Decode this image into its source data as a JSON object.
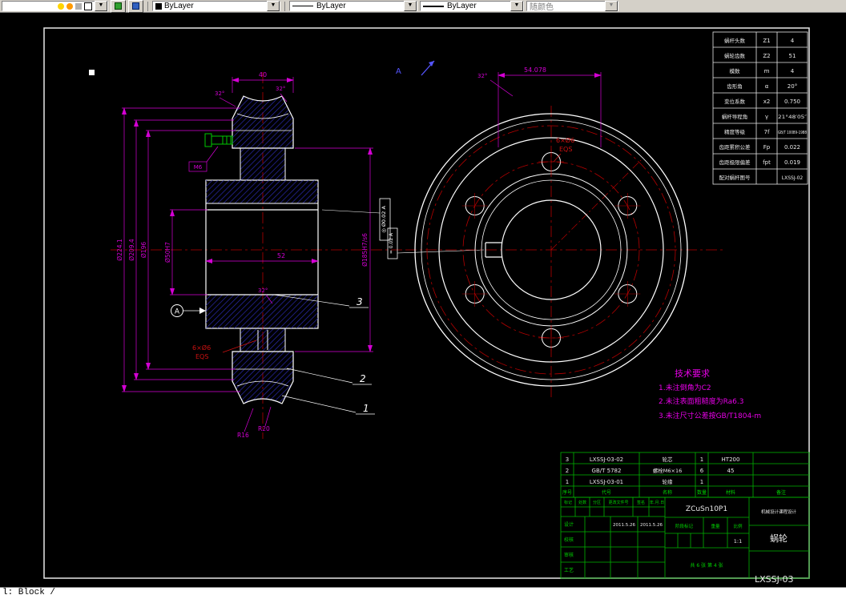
{
  "toolbar": {
    "color_value": "ByLayer",
    "linetype_value": "ByLayer",
    "lineweight_value": "ByLayer",
    "plotstyle_value": "随颜色",
    "dropdown_arrow": "▼"
  },
  "command_line": "l: Block /",
  "sheet_no": "LXSSJ-03",
  "section_mark": "A",
  "gear_table": {
    "rows": [
      [
        "蜗杆头数",
        "Z1",
        "4"
      ],
      [
        "蜗轮齿数",
        "Z2",
        "51"
      ],
      [
        "模数",
        "m",
        "4"
      ],
      [
        "齿形角",
        "α",
        "20°"
      ],
      [
        "变位系数",
        "x2",
        "0.750"
      ],
      [
        "蜗杆导程角",
        "γ",
        "21°48′05″"
      ],
      [
        "精度等级",
        "7f",
        "GB/T 10089-1988"
      ],
      [
        "齿距累积公差",
        "Fp",
        "0.022"
      ],
      [
        "齿距极限偏差",
        "fpt",
        "0.019"
      ],
      [
        "配对蜗杆图号",
        "",
        "LXSSJ-02"
      ]
    ]
  },
  "notes": {
    "title": "技术要求",
    "line1": "1.未注倒角为C2",
    "line2": "2.未注表面粗糙度为Ra6.3",
    "line3": "3.未注尺寸公差按GB/T1804-m"
  },
  "dims": {
    "width_top": "40",
    "angle": "32°",
    "hub_width": "52",
    "od_outer": "Ø224.1",
    "od_mid": "Ø209.4",
    "od_root": "Ø196",
    "bore": "Ø50H7",
    "rim_fit": "Ø185H7/s6",
    "hole_span": "54.078",
    "radius_small": "R16",
    "radius_large": "R20",
    "screw": "M6",
    "datum": "A",
    "holes": "6×Ø6",
    "eqs": "EQS",
    "gdt_circular": "◎ Ø0.02 A",
    "gdt_symmetry": "= 0.02 A"
  },
  "balloons": {
    "b1": "1",
    "b2": "2",
    "b3": "3"
  },
  "bom": {
    "headers": [
      "序号",
      "代号",
      "名称",
      "数量",
      "材料",
      "备注"
    ],
    "rows": [
      [
        "3",
        "LXSSJ-03-02",
        "轮芯",
        "1",
        "HT200",
        ""
      ],
      [
        "2",
        "GB/T 5782",
        "螺栓M6×16",
        "6",
        "45",
        ""
      ],
      [
        "1",
        "LXSSJ-03-01",
        "轮缘",
        "1",
        "",
        ""
      ]
    ]
  },
  "title_block": {
    "material": "ZCuSn10P1",
    "rev_headers": [
      "标记",
      "处数",
      "分区",
      "更改文件号",
      "签名",
      "年.月.日"
    ],
    "sign_rows": [
      "设计",
      "校核",
      "审核",
      "工艺"
    ],
    "date1": "2011.5.26",
    "date2": "2011.5.26",
    "stage_label": "阶段标记",
    "weight_label": "重量",
    "scale_label": "比例",
    "scale_value": "1:1",
    "sheet_note": "共 6 张 第 4 张",
    "unit_name": "机械设计课程设计",
    "part_name": "蜗轮"
  },
  "colors": {
    "dimension": "#d400d4",
    "centerline": "#b40000",
    "hatch": "#2a2aae",
    "table_green": "#00b400",
    "note_magenta": "#e800e8",
    "annotation_blue": "#5555ff"
  }
}
